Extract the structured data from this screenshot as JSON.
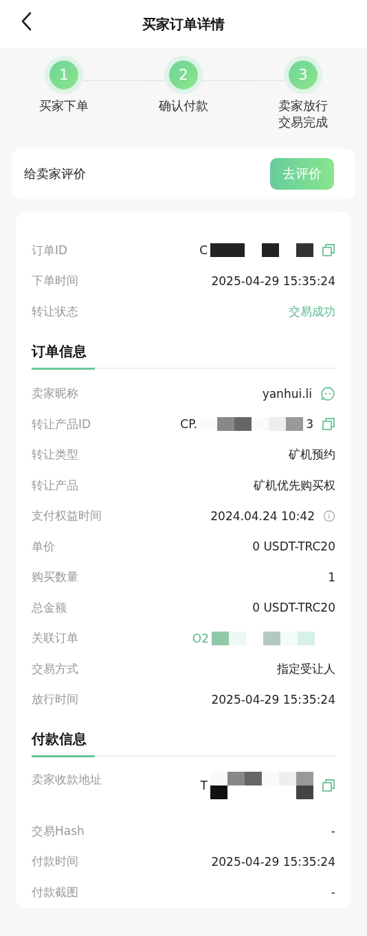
{
  "header": {
    "title": "买家订单详情"
  },
  "steps": [
    {
      "number": "1",
      "label": "买家下单"
    },
    {
      "number": "2",
      "label": "确认付款"
    },
    {
      "number": "3",
      "label": "卖家放行交易完成"
    }
  ],
  "review": {
    "label": "给卖家评价",
    "button": "去评价"
  },
  "order": {
    "rows": [
      {
        "kind": "copy",
        "label": "订单ID",
        "value": "C",
        "redacted": true
      },
      {
        "kind": "text",
        "label": "下单时间",
        "value": "2025-04-29 15:35:24"
      },
      {
        "kind": "status",
        "label": "转让状态",
        "value": "交易成功"
      }
    ]
  },
  "sections": [
    {
      "title": "订单信息",
      "rows": [
        {
          "kind": "chat",
          "label": "卖家昵称",
          "value": "yanhui.li"
        },
        {
          "kind": "copy",
          "label": "转让产品ID",
          "value": "CP.",
          "value_end": "3",
          "redacted": true
        },
        {
          "kind": "text",
          "label": "转让类型",
          "value": "矿机预约"
        },
        {
          "kind": "text",
          "label": "转让产品",
          "value": "矿机优先购买权"
        },
        {
          "kind": "info",
          "label": "支付权益时间",
          "value": "2024.04.24 10:42"
        },
        {
          "kind": "text",
          "label": "单价",
          "value": "0 USDT-TRC20"
        },
        {
          "kind": "text",
          "label": "购买数量",
          "value": "1"
        },
        {
          "kind": "text",
          "label": "总金额",
          "value": "0 USDT-TRC20"
        },
        {
          "kind": "link",
          "label": "关联订单",
          "value": "O2",
          "redacted": true
        },
        {
          "kind": "text",
          "label": "交易方式",
          "value": "指定受让人"
        },
        {
          "kind": "text",
          "label": "放行时间",
          "value": "2025-04-29 15:35:24"
        }
      ]
    },
    {
      "title": "付款信息",
      "rows": [
        {
          "kind": "copy",
          "label": "卖家收款地址",
          "value": "T",
          "redacted": true
        },
        {
          "kind": "text",
          "label": "交易Hash",
          "value": "-"
        },
        {
          "kind": "text",
          "label": "付款时间",
          "value": "2025-04-29 15:35:24"
        },
        {
          "kind": "text",
          "label": "付款截图",
          "value": "-"
        }
      ]
    }
  ]
}
